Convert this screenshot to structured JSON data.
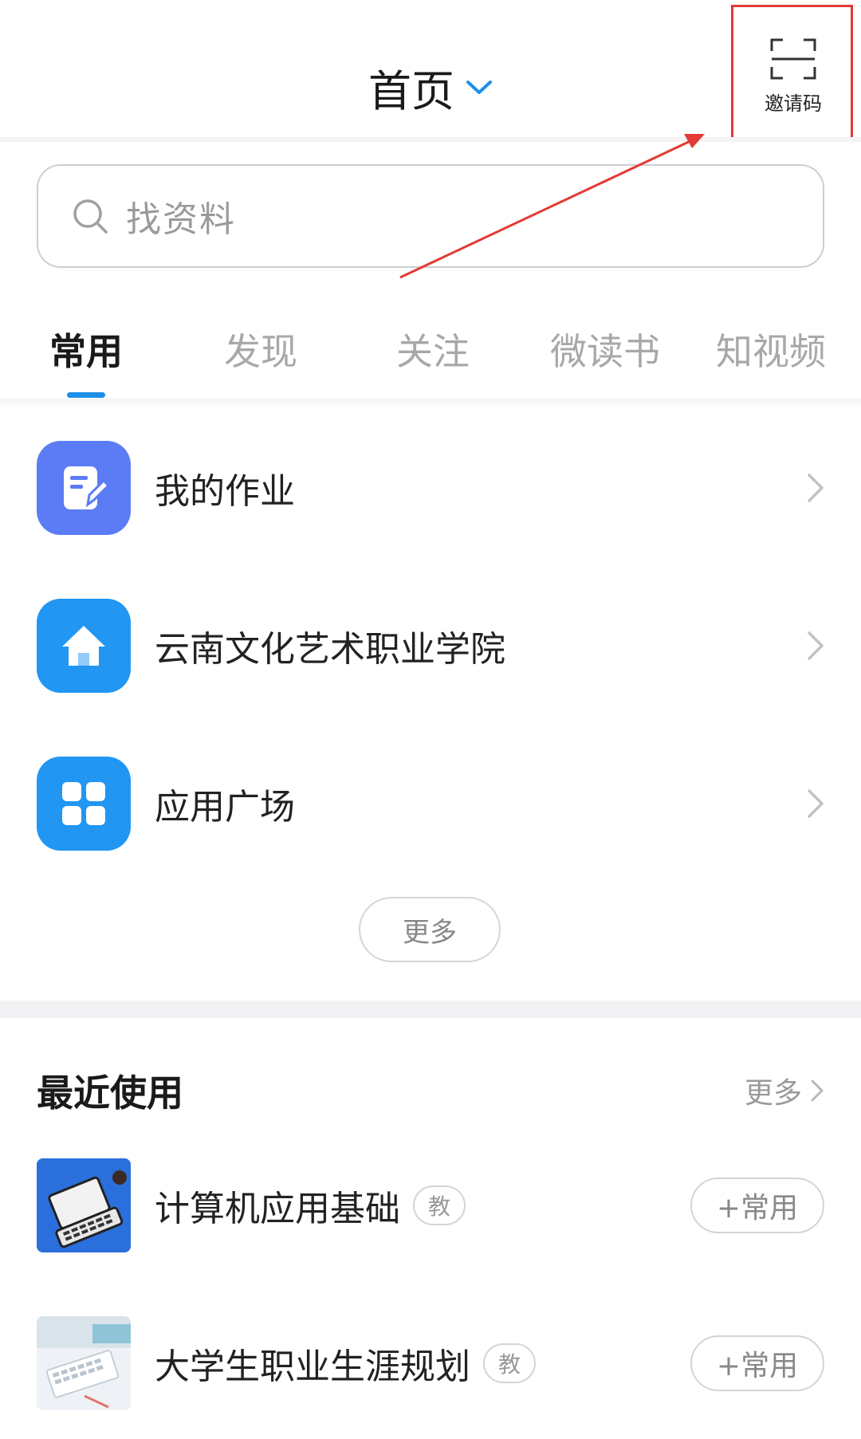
{
  "header": {
    "title": "首页",
    "scan_label": "邀请码"
  },
  "search": {
    "placeholder": "找资料"
  },
  "tabs": [
    {
      "label": "常用",
      "active": true
    },
    {
      "label": "发现",
      "active": false
    },
    {
      "label": "关注",
      "active": false
    },
    {
      "label": "微读书",
      "active": false
    },
    {
      "label": "知视频",
      "active": false
    }
  ],
  "common": [
    {
      "label": "我的作业",
      "icon": "homework-icon",
      "color": "#5b7cf5"
    },
    {
      "label": "云南文化艺术职业学院",
      "icon": "home-icon",
      "color": "#2196f3"
    },
    {
      "label": "应用广场",
      "icon": "app-grid-icon",
      "color": "#2196f3"
    }
  ],
  "common_more": "更多",
  "recent": {
    "title": "最近使用",
    "more": "更多",
    "items": [
      {
        "name": "计算机应用基础",
        "badge": "教",
        "pin": "+常用"
      },
      {
        "name": "大学生职业生涯规划",
        "badge": "教",
        "pin": "+常用"
      }
    ]
  },
  "colors": {
    "accent": "#1e8fe8",
    "highlight": "#e23b36"
  }
}
